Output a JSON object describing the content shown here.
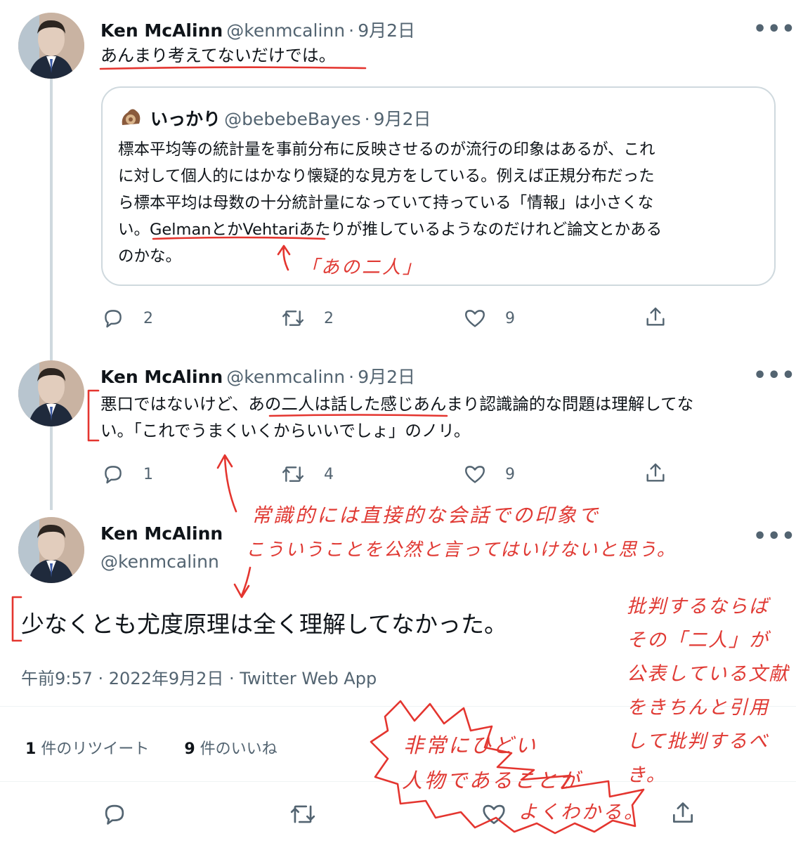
{
  "tweet1": {
    "name": "Ken McAlinn",
    "handle": "@kenmcalinn",
    "dot": "·",
    "date": "9月2日",
    "text": "あんまり考えてないだけでは。",
    "replies": "2",
    "retweets": "2",
    "likes": "9"
  },
  "quote": {
    "name": "いっかり",
    "handle": "@bebebeBayes",
    "dot": "·",
    "date": "9月2日",
    "lines": [
      "標本平均等の統計量を事前分布に反映させるのが流行の印象はあるが、これ",
      "に対して個人的にはかなり懐疑的な見方をしている。例えば正規分布だった",
      "ら標本平均は母数の十分統計量になっていて持っている「情報」は小さくな",
      "い。GelmanとかVehtariあたりが推しているようなのだけれど論文とかある",
      "のかな。"
    ]
  },
  "tweet2": {
    "name": "Ken McAlinn",
    "handle": "@kenmcalinn",
    "dot": "·",
    "date": "9月2日",
    "lines": [
      "悪口ではないけど、あの二人は話した感じあんまり認識論的な問題は理解してな",
      "い。「これでうまくいくからいいでしょ」のノリ。"
    ],
    "replies": "1",
    "retweets": "4",
    "likes": "9"
  },
  "tweet3": {
    "name": "Ken McAlinn",
    "handle": "@kenmcalinn",
    "text": "少なくとも尤度原理は全く理解してなかった。",
    "meta": "午前9:57 · 2022年9月2日 · Twitter Web App",
    "retweet_count": "1",
    "retweet_label": "件のリツイート",
    "like_count": "9",
    "like_label": "件のいいね"
  },
  "annotations": {
    "note_two_people": "「あの二人」",
    "note_common_sense_1": "常識的には直接的な会話での印象で",
    "note_common_sense_2": "こういうことを公然と言ってはいけないと思う。",
    "note_criticize": [
      "批判するならば",
      "その「二人」が",
      "公表している文献",
      "をきちんと引用",
      "して批判するべき。"
    ],
    "note_terrible": [
      "非常にひどい",
      "人物であることが",
      "よくわかる。"
    ]
  },
  "colors": {
    "text": "#0f1419",
    "secondary": "#536471",
    "border": "#cfd9de",
    "annotation_red": "#e4352f"
  },
  "icons": [
    "reply-icon",
    "retweet-icon",
    "like-icon",
    "share-icon",
    "more-icon"
  ]
}
